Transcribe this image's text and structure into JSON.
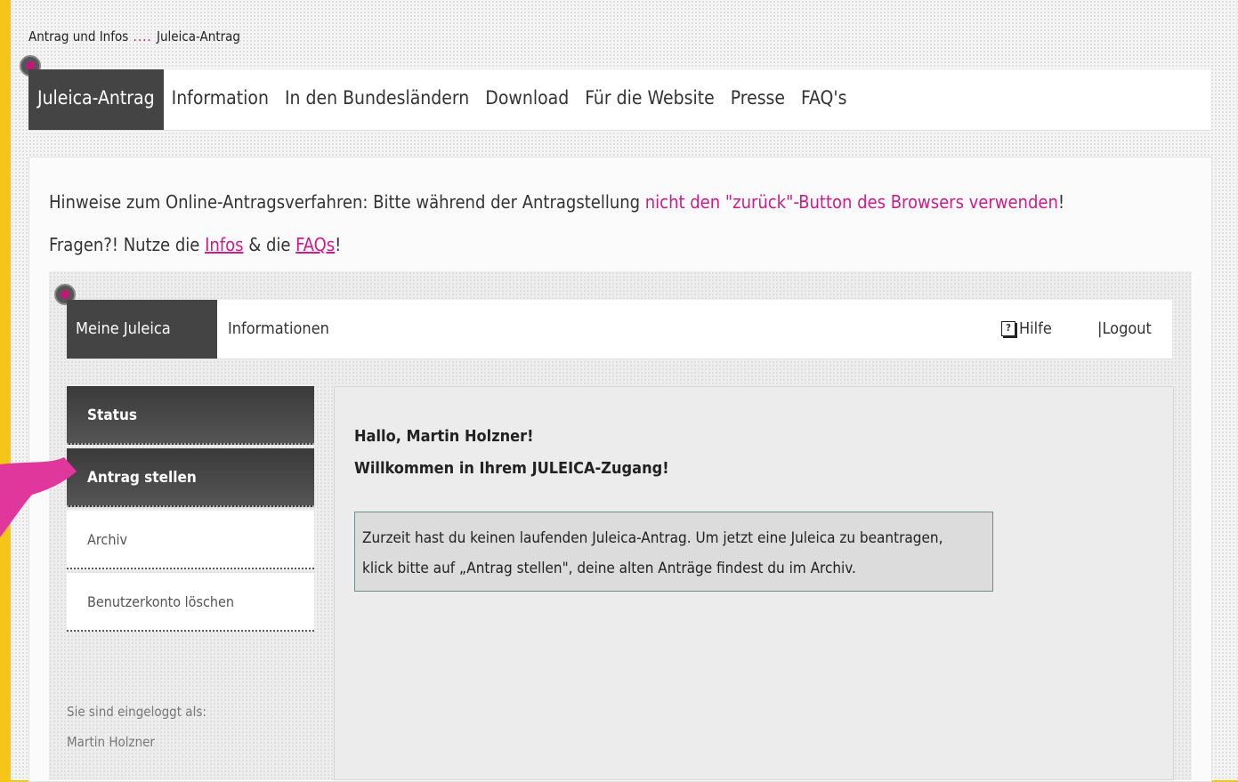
{
  "breadcrumb": {
    "part1": "Antrag und Infos",
    "sep": " .... ",
    "part2": "Juleica-Antrag"
  },
  "topnav": {
    "items": [
      "Juleica-Antrag",
      "Information",
      "In den Bundesländern",
      "Download",
      "Für die Website",
      "Presse",
      "FAQ's"
    ]
  },
  "hint": {
    "prefix": "Hinweise zum Online-Antragsverfahren: Bitte während der Antragstellung ",
    "emph": "nicht den \"zurück\"-Button des Browsers verwenden",
    "suffix": "!"
  },
  "faq_line": {
    "prefix": "Fragen?! Nutze die ",
    "infos": "Infos",
    "mid": " & die ",
    "faqs": "FAQs",
    "suffix": "!"
  },
  "subnav": {
    "tab1": "Meine Juleica",
    "tab2": "Informationen",
    "help_icon": "?",
    "help": "Hilfe",
    "logout": "|Logout"
  },
  "sidebar": {
    "items": [
      "Status",
      "Antrag stellen",
      "Archiv",
      "Benutzerkonto löschen"
    ]
  },
  "logged": {
    "label": "Sie sind eingeloggt als:",
    "name": "Martin Holzner"
  },
  "main": {
    "greet1": "Hallo, Martin Holzner!",
    "greet2": "Willkommen in Ihrem JULEICA-Zugang!",
    "notice_line1": "Zurzeit hast du keinen laufenden Juleica-Antrag. Um jetzt eine Juleica zu beantragen,",
    "notice_line2": "klick bitte auf „Antrag stellen\", deine alten Anträge findest du im Archiv."
  },
  "colors": {
    "accent": "#d11a8a",
    "frame": "#f5c518",
    "nav_active": "#444444"
  }
}
